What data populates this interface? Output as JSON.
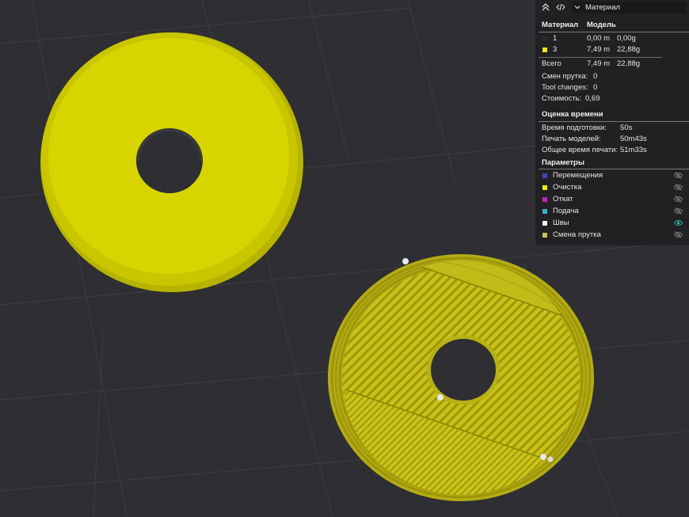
{
  "panel": {
    "view_select": {
      "value": "Материал"
    },
    "material_table": {
      "headers": [
        "Материал",
        "Модель"
      ],
      "rows": [
        {
          "material": "1",
          "length": "0,00 m",
          "weight": "0,00g",
          "color": "#2b2b2b"
        },
        {
          "material": "3",
          "length": "7,49 m",
          "weight": "22,88g",
          "color": "#f0e61c"
        }
      ],
      "total": {
        "label": "Всего",
        "length": "7,49 m",
        "weight": "22,88g"
      }
    },
    "stats": [
      {
        "label": "Смен прутка:",
        "value": "0"
      },
      {
        "label": "Tool changes:",
        "value": "0"
      },
      {
        "label": "Стоимость:",
        "value": "0,69"
      }
    ],
    "time": {
      "title": "Оценка времени",
      "rows": [
        {
          "label": "Время подготовки:",
          "value": "50s"
        },
        {
          "label": "Печать моделей:",
          "value": "50m43s"
        },
        {
          "label": "Общее время печати:",
          "value": "51m33s"
        }
      ]
    },
    "params": {
      "title": "Параметры",
      "items": [
        {
          "label": "Перемещения",
          "color": "#3b49b8",
          "visible": false
        },
        {
          "label": "Очистка",
          "color": "#f3ea14",
          "visible": false
        },
        {
          "label": "Откат",
          "color": "#c224c2",
          "visible": false
        },
        {
          "label": "Подача",
          "color": "#34b5c8",
          "visible": false
        },
        {
          "label": "Швы",
          "color": "#f2f2f2",
          "visible": true
        },
        {
          "label": "Смена прутка",
          "color": "#c8c055",
          "visible": false
        }
      ]
    }
  },
  "colors": {
    "background": "#2e2e33",
    "model_yellow": "#d4d400",
    "toolpath_yellow": "#c9c21c",
    "accent_teal": "#2fb3ad"
  }
}
